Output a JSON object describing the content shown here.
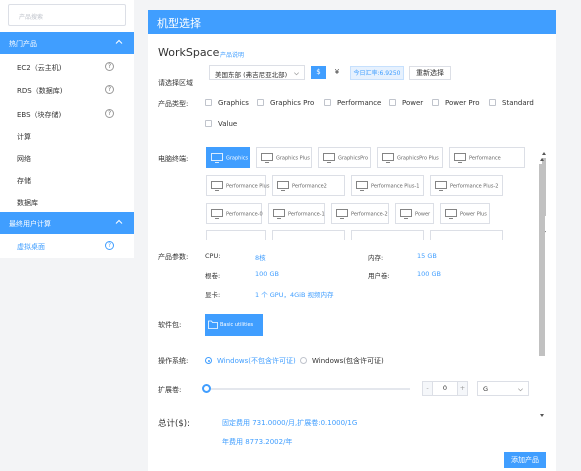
{
  "sidebar": {
    "search_placeholder": "产品搜索",
    "group1_title": "热门产品",
    "items": [
      {
        "label": "EC2（云主机)"
      },
      {
        "label": "RDS（数据库)"
      },
      {
        "label": "EBS（块存储)"
      },
      {
        "label": "计算"
      },
      {
        "label": "网络"
      },
      {
        "label": "存储"
      },
      {
        "label": "数据库"
      }
    ],
    "group2_title": "最终用户计算",
    "active_item": "虚拟桌面",
    "help_glyph": "?"
  },
  "main": {
    "header_title": "机型选择",
    "workspace_title": "WorkSpace",
    "product_doc_link": "产品说明",
    "region_label": "请选择区域",
    "region_value": "美国东部 (弗吉尼亚北部)",
    "currency_usd": "$",
    "currency_cny": "¥",
    "rate_text": "今日汇率:6.9250",
    "reset_label": "重新选择",
    "product_type_label": "产品类型:",
    "product_types": [
      "Graphics",
      "Graphics Pro",
      "Performance",
      "Power",
      "Power Pro",
      "Standard",
      "Value"
    ],
    "terminal_label": "电脑终端:",
    "terminals": [
      "Graphics",
      "Graphics Plus",
      "GraphicsPro",
      "GraphicsPro Plus",
      "Performance",
      "Performance Plus",
      "Performance2",
      "Performance Plus-1",
      "Performance Plus-2",
      "Performance-0",
      "Performance-1",
      "Performance-2",
      "Power",
      "Power Plus"
    ],
    "params_label": "产品参数:",
    "params": {
      "cpu_label": "CPU:",
      "cpu_value": "8核",
      "memory_label": "内存:",
      "memory_value": "15 GB",
      "root_label": "根卷:",
      "root_value": "100 GB",
      "user_label": "用户卷:",
      "user_value": "100 GB",
      "gpu_label": "显卡:",
      "gpu_value": "1 个 GPU，4GiB 视频内存"
    },
    "software_label": "软件包:",
    "software_card": "Basic utilities",
    "os_label": "操作系统:",
    "os_options": [
      "Windows(不包含许可证)",
      "Windows(包含许可证)"
    ],
    "expand_label": "扩展卷:",
    "expand_value": "0",
    "expand_unit": "G",
    "total_label": "总计($):",
    "total_line1": "固定费用 731.0000/月,扩展卷:0.1000/1G",
    "total_line2": "年费用 8773.2002/年",
    "add_label": "添加产品"
  },
  "colors": {
    "accent": "#409eff"
  }
}
